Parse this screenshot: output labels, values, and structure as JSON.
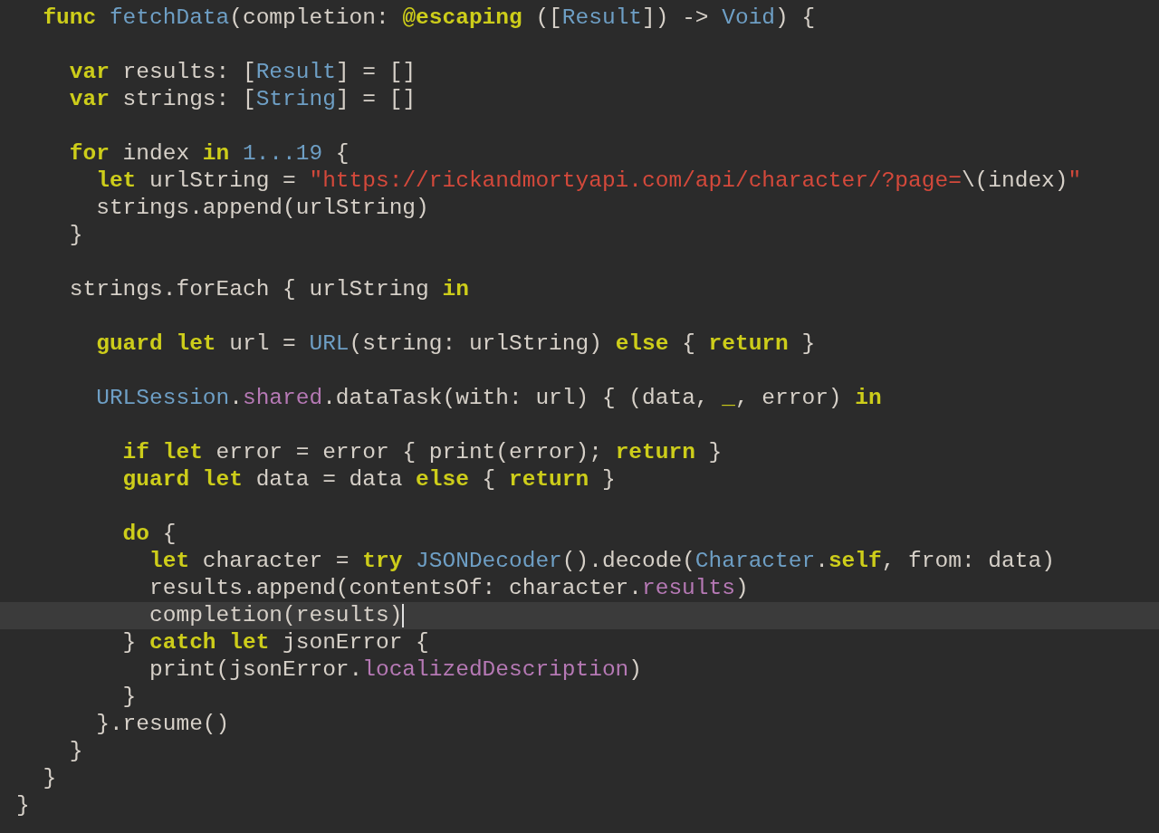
{
  "editor": {
    "lines": [
      {
        "kind": "code",
        "current": false,
        "tokens": [
          {
            "text": "  func ",
            "kind": "keyword"
          },
          {
            "text": "fetchData",
            "kind": "type"
          },
          {
            "text": "(completion: ",
            "kind": "plain"
          },
          {
            "text": "@escaping",
            "kind": "keyword"
          },
          {
            "text": " ([",
            "kind": "plain"
          },
          {
            "text": "Result",
            "kind": "type"
          },
          {
            "text": "]) -> ",
            "kind": "plain"
          },
          {
            "text": "Void",
            "kind": "type"
          },
          {
            "text": ") {",
            "kind": "plain"
          }
        ]
      },
      {
        "kind": "blank"
      },
      {
        "kind": "code",
        "current": false,
        "tokens": [
          {
            "text": "    var",
            "kind": "keyword"
          },
          {
            "text": " results: [",
            "kind": "plain"
          },
          {
            "text": "Result",
            "kind": "type"
          },
          {
            "text": "] = []",
            "kind": "plain"
          }
        ]
      },
      {
        "kind": "code",
        "current": false,
        "tokens": [
          {
            "text": "    var",
            "kind": "keyword"
          },
          {
            "text": " strings: [",
            "kind": "plain"
          },
          {
            "text": "String",
            "kind": "type"
          },
          {
            "text": "] = []",
            "kind": "plain"
          }
        ]
      },
      {
        "kind": "blank"
      },
      {
        "kind": "code",
        "current": false,
        "tokens": [
          {
            "text": "    for",
            "kind": "keyword"
          },
          {
            "text": " index ",
            "kind": "plain"
          },
          {
            "text": "in ",
            "kind": "keyword"
          },
          {
            "text": "1...19",
            "kind": "number"
          },
          {
            "text": " {",
            "kind": "plain"
          }
        ]
      },
      {
        "kind": "code",
        "current": false,
        "tokens": [
          {
            "text": "      let",
            "kind": "keyword"
          },
          {
            "text": " urlString = ",
            "kind": "plain"
          },
          {
            "text": "\"https://rickandmortyapi.com/api/character/?page=",
            "kind": "string"
          },
          {
            "text": "\\(index)",
            "kind": "plain"
          },
          {
            "text": "\"",
            "kind": "string"
          }
        ]
      },
      {
        "kind": "code",
        "current": false,
        "tokens": [
          {
            "text": "      strings.append(urlString)",
            "kind": "plain"
          }
        ]
      },
      {
        "kind": "code",
        "current": false,
        "tokens": [
          {
            "text": "    }",
            "kind": "plain"
          }
        ]
      },
      {
        "kind": "blank"
      },
      {
        "kind": "code",
        "current": false,
        "tokens": [
          {
            "text": "    strings.forEach { urlString ",
            "kind": "plain"
          },
          {
            "text": "in",
            "kind": "keyword"
          }
        ]
      },
      {
        "kind": "blank"
      },
      {
        "kind": "code",
        "current": false,
        "tokens": [
          {
            "text": "      guard let",
            "kind": "keyword"
          },
          {
            "text": " url = ",
            "kind": "plain"
          },
          {
            "text": "URL",
            "kind": "type"
          },
          {
            "text": "(string: urlString) ",
            "kind": "plain"
          },
          {
            "text": "else",
            "kind": "keyword"
          },
          {
            "text": " { ",
            "kind": "plain"
          },
          {
            "text": "return",
            "kind": "keyword"
          },
          {
            "text": " }",
            "kind": "plain"
          }
        ]
      },
      {
        "kind": "blank"
      },
      {
        "kind": "code",
        "current": false,
        "tokens": [
          {
            "text": "      URLSession",
            "kind": "type"
          },
          {
            "text": ".",
            "kind": "plain"
          },
          {
            "text": "shared",
            "kind": "property"
          },
          {
            "text": ".dataTask(with: url) { (data, ",
            "kind": "plain"
          },
          {
            "text": "_",
            "kind": "keyword"
          },
          {
            "text": ", error) ",
            "kind": "plain"
          },
          {
            "text": "in",
            "kind": "keyword"
          }
        ]
      },
      {
        "kind": "blank"
      },
      {
        "kind": "code",
        "current": false,
        "tokens": [
          {
            "text": "        if let",
            "kind": "keyword"
          },
          {
            "text": " error = error { print(error); ",
            "kind": "plain"
          },
          {
            "text": "return",
            "kind": "keyword"
          },
          {
            "text": " }",
            "kind": "plain"
          }
        ]
      },
      {
        "kind": "code",
        "current": false,
        "tokens": [
          {
            "text": "        guard let",
            "kind": "keyword"
          },
          {
            "text": " data = data ",
            "kind": "plain"
          },
          {
            "text": "else",
            "kind": "keyword"
          },
          {
            "text": " { ",
            "kind": "plain"
          },
          {
            "text": "return",
            "kind": "keyword"
          },
          {
            "text": " }",
            "kind": "plain"
          }
        ]
      },
      {
        "kind": "blank"
      },
      {
        "kind": "code",
        "current": false,
        "tokens": [
          {
            "text": "        do",
            "kind": "keyword"
          },
          {
            "text": " {",
            "kind": "plain"
          }
        ]
      },
      {
        "kind": "code",
        "current": false,
        "tokens": [
          {
            "text": "          let",
            "kind": "keyword"
          },
          {
            "text": " character = ",
            "kind": "plain"
          },
          {
            "text": "try ",
            "kind": "keyword"
          },
          {
            "text": "JSONDecoder",
            "kind": "type"
          },
          {
            "text": "().decode(",
            "kind": "plain"
          },
          {
            "text": "Character",
            "kind": "type"
          },
          {
            "text": ".",
            "kind": "plain"
          },
          {
            "text": "self",
            "kind": "keyword"
          },
          {
            "text": ", from: data)",
            "kind": "plain"
          }
        ]
      },
      {
        "kind": "code",
        "current": false,
        "tokens": [
          {
            "text": "          results.append(contentsOf: character.",
            "kind": "plain"
          },
          {
            "text": "results",
            "kind": "property"
          },
          {
            "text": ")",
            "kind": "plain"
          }
        ]
      },
      {
        "kind": "code",
        "current": true,
        "tokens": [
          {
            "text": "          completion(results)",
            "kind": "plain"
          }
        ]
      },
      {
        "kind": "code",
        "current": false,
        "tokens": [
          {
            "text": "        } ",
            "kind": "plain"
          },
          {
            "text": "catch let",
            "kind": "keyword"
          },
          {
            "text": " jsonError {",
            "kind": "plain"
          }
        ]
      },
      {
        "kind": "code",
        "current": false,
        "tokens": [
          {
            "text": "          print(jsonError.",
            "kind": "plain"
          },
          {
            "text": "localizedDescription",
            "kind": "property"
          },
          {
            "text": ")",
            "kind": "plain"
          }
        ]
      },
      {
        "kind": "code",
        "current": false,
        "tokens": [
          {
            "text": "        }",
            "kind": "plain"
          }
        ]
      },
      {
        "kind": "code",
        "current": false,
        "tokens": [
          {
            "text": "      }.resume()",
            "kind": "plain"
          }
        ]
      },
      {
        "kind": "code",
        "current": false,
        "tokens": [
          {
            "text": "    }",
            "kind": "plain"
          }
        ]
      },
      {
        "kind": "code",
        "current": false,
        "tokens": [
          {
            "text": "  }",
            "kind": "plain"
          }
        ]
      },
      {
        "kind": "code",
        "current": false,
        "tokens": [
          {
            "text": "}",
            "kind": "plain"
          }
        ]
      }
    ]
  }
}
